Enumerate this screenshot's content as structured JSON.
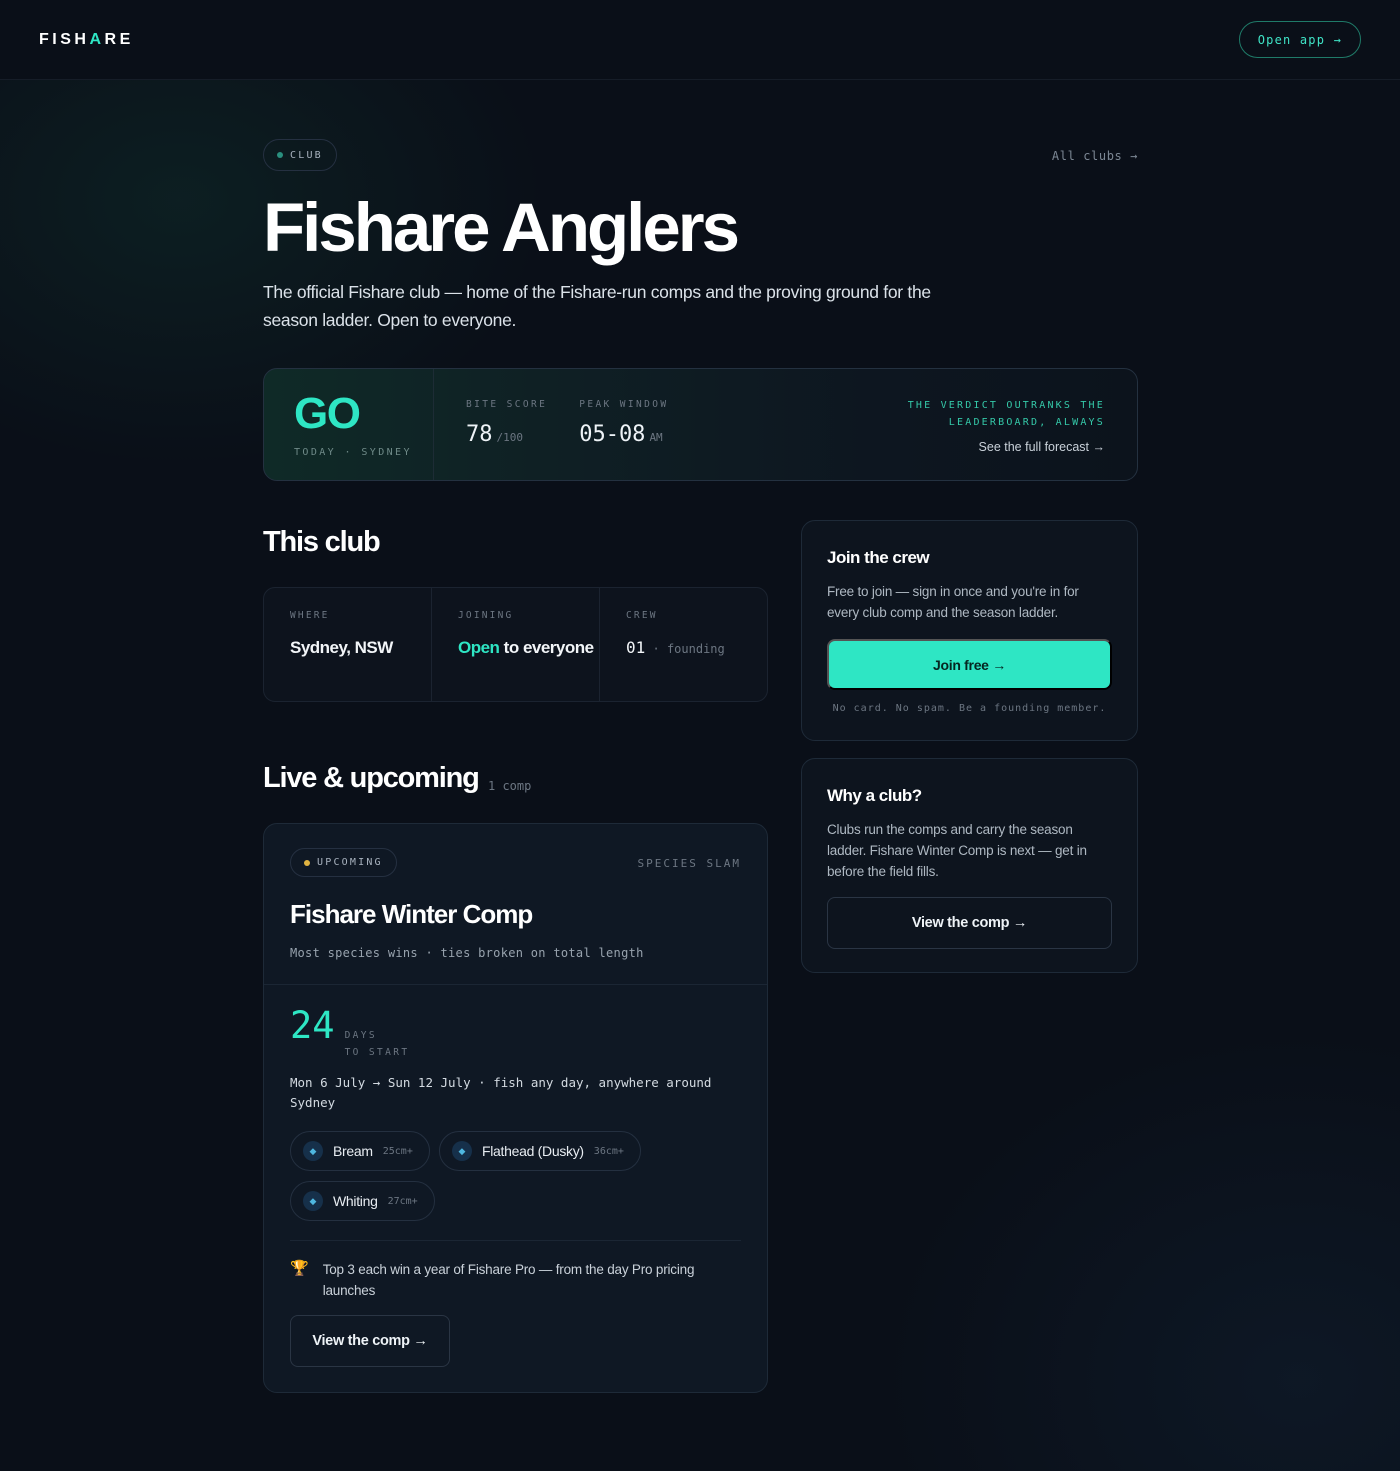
{
  "header": {
    "logo_pre": "FISH",
    "logo_accent": "A",
    "logo_post": "RE",
    "open_app": "Open app →"
  },
  "hero": {
    "badge": "CLUB",
    "all_clubs": "All clubs →",
    "title": "Fishare Anglers",
    "description": "The official Fishare club — home of the Fishare-run comps and the proving ground for the season ladder. Open to everyone."
  },
  "forecast": {
    "verdict": "GO",
    "verdict_sub": "TODAY · SYDNEY",
    "bite_score_label": "BITE SCORE",
    "bite_score_value": "78",
    "bite_score_unit": "/100",
    "peak_window_label": "PEAK WINDOW",
    "peak_window_value": "05-08",
    "peak_window_unit": "AM",
    "tagline_line1": "THE VERDICT OUTRANKS THE",
    "tagline_line2": "LEADERBOARD, ALWAYS",
    "forecast_link": "See the full forecast →"
  },
  "this_club": {
    "heading": "This club",
    "where_label": "WHERE",
    "where_value": "Sydney, NSW",
    "joining_label": "JOINING",
    "joining_highlight": "Open",
    "joining_rest": " to everyone",
    "crew_label": "CREW",
    "crew_value": "01",
    "crew_note": " · founding"
  },
  "live": {
    "heading": "Live & upcoming",
    "count": "1 comp"
  },
  "comp": {
    "status": "UPCOMING",
    "type": "SPECIES SLAM",
    "title": "Fishare Winter Comp",
    "rules": "Most species wins · ties broken on total length",
    "days": "24",
    "days_label_1": "DAYS",
    "days_label_2": "TO START",
    "dates": "Mon 6 July → Sun 12 July · fish any day, anywhere around Sydney",
    "species": [
      {
        "name": "Bream",
        "size": "25cm+"
      },
      {
        "name": "Flathead (Dusky)",
        "size": "36cm+"
      },
      {
        "name": "Whiting",
        "size": "27cm+"
      }
    ],
    "prize": "Top 3 each win a year of Fishare Pro — from the day Pro pricing launches",
    "view_button": "View the comp →"
  },
  "join_card": {
    "title": "Join the crew",
    "text": "Free to join — sign in once and you're in for every club comp and the season ladder.",
    "button": "Join free →",
    "note": "No card. No spam. Be a founding member."
  },
  "why_card": {
    "title": "Why a club?",
    "text": "Clubs run the comps and carry the season ladder. Fishare Winter Comp is next — get in before the field fills.",
    "button": "View the comp →"
  },
  "colors": {
    "accent": "#2ee6c4",
    "background": "#0a0f18",
    "upcoming_dot": "#e0b341"
  }
}
